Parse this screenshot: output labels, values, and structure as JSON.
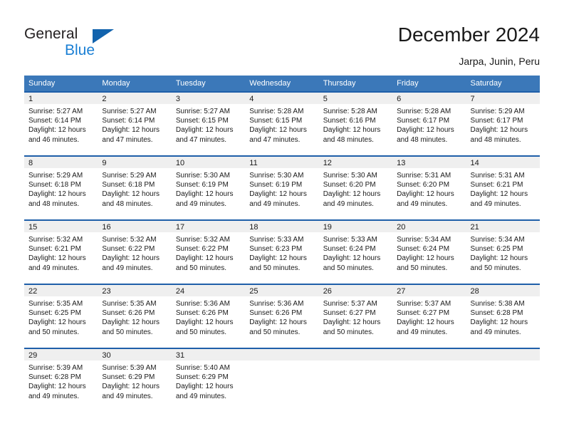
{
  "brand": {
    "name_part1": "General",
    "name_part2": "Blue",
    "triangle_icon": "triangle-icon",
    "accent_color": "#1263ad",
    "blue_text_color": "#1a7fd4"
  },
  "header": {
    "title": "December 2024",
    "location": "Jarpa, Junin, Peru"
  },
  "calendar": {
    "header_bg": "#3b78b9",
    "daynum_bg": "#efefef",
    "rule_color": "#1f5fa9",
    "weekdays": [
      "Sunday",
      "Monday",
      "Tuesday",
      "Wednesday",
      "Thursday",
      "Friday",
      "Saturday"
    ],
    "weeks": [
      [
        {
          "day": "1",
          "sunrise": "Sunrise: 5:27 AM",
          "sunset": "Sunset: 6:14 PM",
          "daylight1": "Daylight: 12 hours",
          "daylight2": "and 46 minutes."
        },
        {
          "day": "2",
          "sunrise": "Sunrise: 5:27 AM",
          "sunset": "Sunset: 6:14 PM",
          "daylight1": "Daylight: 12 hours",
          "daylight2": "and 47 minutes."
        },
        {
          "day": "3",
          "sunrise": "Sunrise: 5:27 AM",
          "sunset": "Sunset: 6:15 PM",
          "daylight1": "Daylight: 12 hours",
          "daylight2": "and 47 minutes."
        },
        {
          "day": "4",
          "sunrise": "Sunrise: 5:28 AM",
          "sunset": "Sunset: 6:15 PM",
          "daylight1": "Daylight: 12 hours",
          "daylight2": "and 47 minutes."
        },
        {
          "day": "5",
          "sunrise": "Sunrise: 5:28 AM",
          "sunset": "Sunset: 6:16 PM",
          "daylight1": "Daylight: 12 hours",
          "daylight2": "and 48 minutes."
        },
        {
          "day": "6",
          "sunrise": "Sunrise: 5:28 AM",
          "sunset": "Sunset: 6:17 PM",
          "daylight1": "Daylight: 12 hours",
          "daylight2": "and 48 minutes."
        },
        {
          "day": "7",
          "sunrise": "Sunrise: 5:29 AM",
          "sunset": "Sunset: 6:17 PM",
          "daylight1": "Daylight: 12 hours",
          "daylight2": "and 48 minutes."
        }
      ],
      [
        {
          "day": "8",
          "sunrise": "Sunrise: 5:29 AM",
          "sunset": "Sunset: 6:18 PM",
          "daylight1": "Daylight: 12 hours",
          "daylight2": "and 48 minutes."
        },
        {
          "day": "9",
          "sunrise": "Sunrise: 5:29 AM",
          "sunset": "Sunset: 6:18 PM",
          "daylight1": "Daylight: 12 hours",
          "daylight2": "and 48 minutes."
        },
        {
          "day": "10",
          "sunrise": "Sunrise: 5:30 AM",
          "sunset": "Sunset: 6:19 PM",
          "daylight1": "Daylight: 12 hours",
          "daylight2": "and 49 minutes."
        },
        {
          "day": "11",
          "sunrise": "Sunrise: 5:30 AM",
          "sunset": "Sunset: 6:19 PM",
          "daylight1": "Daylight: 12 hours",
          "daylight2": "and 49 minutes."
        },
        {
          "day": "12",
          "sunrise": "Sunrise: 5:30 AM",
          "sunset": "Sunset: 6:20 PM",
          "daylight1": "Daylight: 12 hours",
          "daylight2": "and 49 minutes."
        },
        {
          "day": "13",
          "sunrise": "Sunrise: 5:31 AM",
          "sunset": "Sunset: 6:20 PM",
          "daylight1": "Daylight: 12 hours",
          "daylight2": "and 49 minutes."
        },
        {
          "day": "14",
          "sunrise": "Sunrise: 5:31 AM",
          "sunset": "Sunset: 6:21 PM",
          "daylight1": "Daylight: 12 hours",
          "daylight2": "and 49 minutes."
        }
      ],
      [
        {
          "day": "15",
          "sunrise": "Sunrise: 5:32 AM",
          "sunset": "Sunset: 6:21 PM",
          "daylight1": "Daylight: 12 hours",
          "daylight2": "and 49 minutes."
        },
        {
          "day": "16",
          "sunrise": "Sunrise: 5:32 AM",
          "sunset": "Sunset: 6:22 PM",
          "daylight1": "Daylight: 12 hours",
          "daylight2": "and 49 minutes."
        },
        {
          "day": "17",
          "sunrise": "Sunrise: 5:32 AM",
          "sunset": "Sunset: 6:22 PM",
          "daylight1": "Daylight: 12 hours",
          "daylight2": "and 50 minutes."
        },
        {
          "day": "18",
          "sunrise": "Sunrise: 5:33 AM",
          "sunset": "Sunset: 6:23 PM",
          "daylight1": "Daylight: 12 hours",
          "daylight2": "and 50 minutes."
        },
        {
          "day": "19",
          "sunrise": "Sunrise: 5:33 AM",
          "sunset": "Sunset: 6:24 PM",
          "daylight1": "Daylight: 12 hours",
          "daylight2": "and 50 minutes."
        },
        {
          "day": "20",
          "sunrise": "Sunrise: 5:34 AM",
          "sunset": "Sunset: 6:24 PM",
          "daylight1": "Daylight: 12 hours",
          "daylight2": "and 50 minutes."
        },
        {
          "day": "21",
          "sunrise": "Sunrise: 5:34 AM",
          "sunset": "Sunset: 6:25 PM",
          "daylight1": "Daylight: 12 hours",
          "daylight2": "and 50 minutes."
        }
      ],
      [
        {
          "day": "22",
          "sunrise": "Sunrise: 5:35 AM",
          "sunset": "Sunset: 6:25 PM",
          "daylight1": "Daylight: 12 hours",
          "daylight2": "and 50 minutes."
        },
        {
          "day": "23",
          "sunrise": "Sunrise: 5:35 AM",
          "sunset": "Sunset: 6:26 PM",
          "daylight1": "Daylight: 12 hours",
          "daylight2": "and 50 minutes."
        },
        {
          "day": "24",
          "sunrise": "Sunrise: 5:36 AM",
          "sunset": "Sunset: 6:26 PM",
          "daylight1": "Daylight: 12 hours",
          "daylight2": "and 50 minutes."
        },
        {
          "day": "25",
          "sunrise": "Sunrise: 5:36 AM",
          "sunset": "Sunset: 6:26 PM",
          "daylight1": "Daylight: 12 hours",
          "daylight2": "and 50 minutes."
        },
        {
          "day": "26",
          "sunrise": "Sunrise: 5:37 AM",
          "sunset": "Sunset: 6:27 PM",
          "daylight1": "Daylight: 12 hours",
          "daylight2": "and 50 minutes."
        },
        {
          "day": "27",
          "sunrise": "Sunrise: 5:37 AM",
          "sunset": "Sunset: 6:27 PM",
          "daylight1": "Daylight: 12 hours",
          "daylight2": "and 49 minutes."
        },
        {
          "day": "28",
          "sunrise": "Sunrise: 5:38 AM",
          "sunset": "Sunset: 6:28 PM",
          "daylight1": "Daylight: 12 hours",
          "daylight2": "and 49 minutes."
        }
      ],
      [
        {
          "day": "29",
          "sunrise": "Sunrise: 5:39 AM",
          "sunset": "Sunset: 6:28 PM",
          "daylight1": "Daylight: 12 hours",
          "daylight2": "and 49 minutes."
        },
        {
          "day": "30",
          "sunrise": "Sunrise: 5:39 AM",
          "sunset": "Sunset: 6:29 PM",
          "daylight1": "Daylight: 12 hours",
          "daylight2": "and 49 minutes."
        },
        {
          "day": "31",
          "sunrise": "Sunrise: 5:40 AM",
          "sunset": "Sunset: 6:29 PM",
          "daylight1": "Daylight: 12 hours",
          "daylight2": "and 49 minutes."
        },
        {
          "day": "",
          "sunrise": "",
          "sunset": "",
          "daylight1": "",
          "daylight2": ""
        },
        {
          "day": "",
          "sunrise": "",
          "sunset": "",
          "daylight1": "",
          "daylight2": ""
        },
        {
          "day": "",
          "sunrise": "",
          "sunset": "",
          "daylight1": "",
          "daylight2": ""
        },
        {
          "day": "",
          "sunrise": "",
          "sunset": "",
          "daylight1": "",
          "daylight2": ""
        }
      ]
    ]
  }
}
